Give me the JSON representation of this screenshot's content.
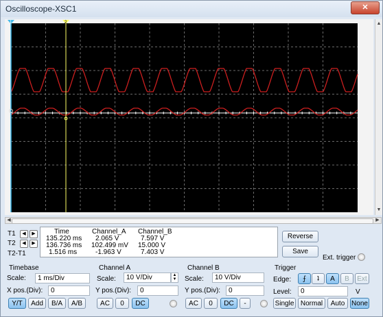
{
  "window": {
    "title": "Oscilloscope-XSC1",
    "close_glyph": "✕"
  },
  "markers": {
    "t1_label": "1",
    "t2_label": "2"
  },
  "readout": {
    "row_labels": [
      "T1",
      "T2",
      "T2-T1"
    ],
    "headers": {
      "time": "Time",
      "channel_a": "Channel_A",
      "channel_b": "Channel_B"
    },
    "rows": [
      {
        "time": "135.220 ms",
        "channel_a": "2.065 V",
        "channel_b": "7.597 V"
      },
      {
        "time": "136.736 ms",
        "channel_a": "102.499 mV",
        "channel_b": "15.000 V"
      },
      {
        "time": "1.516 ms",
        "channel_a": "-1.963 V",
        "channel_b": "7.403 V"
      }
    ]
  },
  "buttons": {
    "reverse": "Reverse",
    "save": "Save",
    "ext_trigger": "Ext. trigger"
  },
  "timebase": {
    "heading": "Timebase",
    "scale_label": "Scale:",
    "scale_value": "1 ms/Div",
    "xpos_label": "X pos.(Div):",
    "xpos_value": "0",
    "modes": [
      "Y/T",
      "Add",
      "B/A",
      "A/B"
    ],
    "selected_mode": "Y/T"
  },
  "channel_a": {
    "heading": "Channel A",
    "scale_label": "Scale:",
    "scale_value": "10  V/Div",
    "ypos_label": "Y pos.(Div):",
    "ypos_value": "0",
    "coupling": [
      "AC",
      "0",
      "DC"
    ],
    "selected": "DC"
  },
  "channel_b": {
    "heading": "Channel B",
    "scale_label": "Scale:",
    "scale_value": "10  V/Div",
    "ypos_label": "Y pos.(Div):",
    "ypos_value": "0",
    "coupling": [
      "AC",
      "0",
      "DC",
      "-"
    ],
    "selected": "DC"
  },
  "trigger": {
    "heading": "Trigger",
    "edge_label": "Edge:",
    "edge_rise": "⨍",
    "edge_fall": "ʇ",
    "sources": [
      "A",
      "B",
      "Ext"
    ],
    "selected_source": "A",
    "level_label": "Level:",
    "level_value": "0",
    "level_unit": "V",
    "modes": [
      "Single",
      "Normal",
      "Auto",
      "None"
    ],
    "selected_mode": "None"
  },
  "icons": {
    "nav_left": "◀",
    "nav_right": "▶",
    "scroll_up": "▲",
    "scroll_down": "▼",
    "scroll_left": "◀",
    "scroll_right": "▶"
  },
  "colors": {
    "screen_bg": "#000000",
    "grid": "#6a6a6a",
    "trace": "#cc1f1f",
    "axis": "#ffffff",
    "cursor_t1": "#3fb8e8",
    "cursor_t2": "#ffff66"
  }
}
